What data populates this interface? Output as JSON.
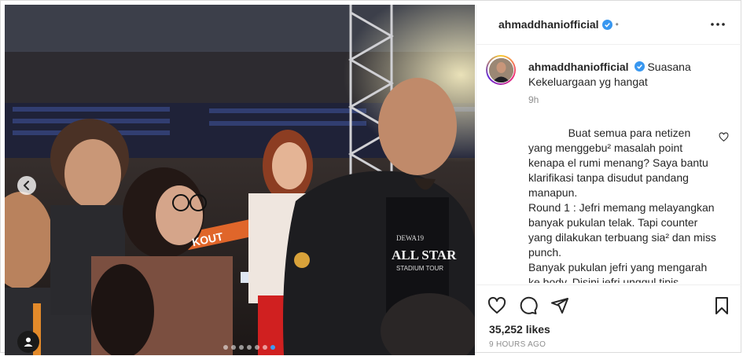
{
  "post": {
    "username": "ahmaddhaniofficial",
    "header_separator": "•",
    "caption": "Suasana Kekeluargaan yg hangat",
    "time": "9h",
    "comment": "             Buat semua para netizen yang menggebu² masalah point kenapa el rumi menang? Saya bantu klarifikasi tanpa disudut pandang manapun.\nRound 1 : Jefri memang melayangkan banyak pukulan telak. Tapi counter yang dilakukan terbuang sia² dan miss punch.\nBanyak pukulan jefri yang mengarah ke body. Disini jefri unggul tipis",
    "likes": "35,252 likes",
    "posted_ago": "9 HOURS AGO"
  },
  "photo": {
    "shirt_text_top": "DEWA19",
    "shirt_text_main": "ALL STAR",
    "shirt_text_sub": "STADIUM TOUR",
    "banner_text": "KOUT"
  },
  "carousel": {
    "slide_count": 7,
    "active_index": 6
  },
  "colors": {
    "verified": "#3897f0",
    "active_dot": "#3d9bf5",
    "border": "#dbdbdb",
    "muted": "#8e8e8e"
  },
  "icons": [
    "verified-badge-icon",
    "more-options-icon",
    "heart-icon",
    "comment-icon",
    "share-icon",
    "bookmark-icon",
    "chevron-left-icon",
    "user-tag-icon",
    "comment-like-icon"
  ]
}
